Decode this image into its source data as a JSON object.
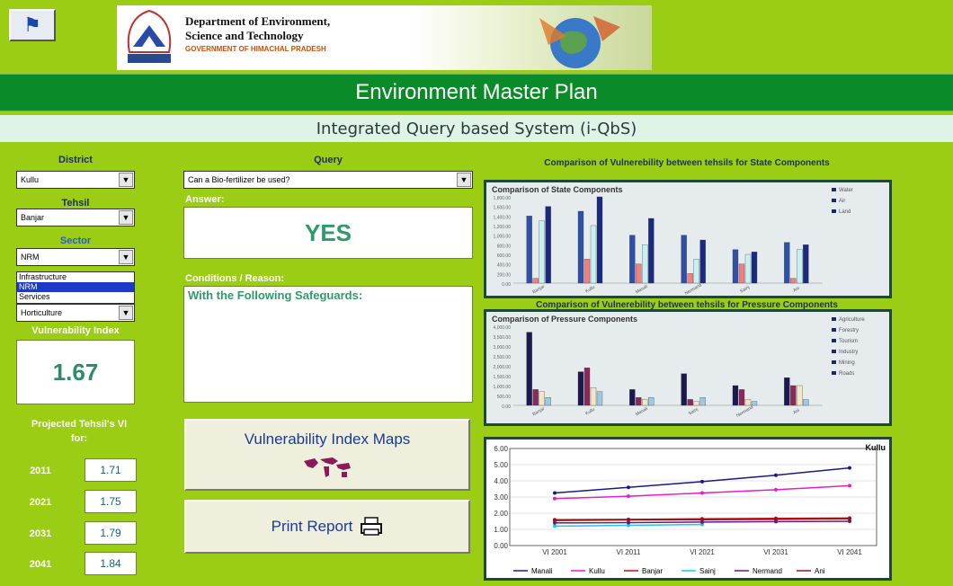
{
  "header": {
    "dept_line1": "Department of Environment,",
    "dept_line2": "Science and Technology",
    "dept_line3": "GOVERNMENT OF HIMACHAL PRADESH",
    "title": "Environment Master Plan",
    "subtitle": "Integrated Query based System (i-QbS)"
  },
  "filters": {
    "district_label": "District",
    "district_value": "Kullu",
    "tehsil_label": "Tehsil",
    "tehsil_value": "Banjar",
    "sector_label": "Sector",
    "sector_value": "NRM",
    "sector_options": [
      "Infrastructure",
      "NRM",
      "Services"
    ],
    "subsector_value": "Horticulture"
  },
  "vulnerability": {
    "label": "Vulnerability Index",
    "value": "1.67",
    "projected_label": "Projected Tehsil's VI for:",
    "years": [
      {
        "year": "2011",
        "value": "1.71"
      },
      {
        "year": "2021",
        "value": "1.75"
      },
      {
        "year": "2031",
        "value": "1.79"
      },
      {
        "year": "2041",
        "value": "1.84"
      }
    ]
  },
  "query": {
    "label": "Query",
    "value": "Can a Bio-fertilizer be used?",
    "answer_label": "Answer:",
    "answer": "YES",
    "conditions_label": "Conditions / Reason:",
    "conditions_text": "With the Following Safeguards:"
  },
  "buttons": {
    "maps": "Vulnerability Index Maps",
    "print": "Print Report"
  },
  "charts": {
    "state_title": "Comparison of Vulnerebility between tehsils for State Components",
    "state_inner_title": "Comparison of State Components",
    "pressure_title": "Comparison of Vulnerebility between tehsils for Pressure Components",
    "pressure_inner_title": "Comparison of Pressure Components"
  },
  "chart_data": [
    {
      "type": "bar",
      "title": "Comparison of State Components",
      "categories": [
        "Banjar",
        "Kullu",
        "Manali",
        "Nermand",
        "Sainj",
        "Ani"
      ],
      "ylim": [
        0,
        1800
      ],
      "ytick_labels": [
        "1,800.00",
        "1,600.00",
        "1,400.00",
        "1,200.00",
        "1,000.00",
        "800.00",
        "600.00",
        "400.00",
        "200.00",
        "0.00"
      ],
      "legend_labels": [
        "Water",
        "Air",
        "Land"
      ],
      "legend_position": "right",
      "series": [
        {
          "name": "Water",
          "color": "#3050a8",
          "values": [
            1400,
            1500,
            1000,
            1000,
            700,
            850
          ]
        },
        {
          "name": "Air",
          "color": "#f08080",
          "values": [
            100,
            500,
            400,
            200,
            400,
            100
          ]
        },
        {
          "name": "Land",
          "color": "#c8f0f0",
          "values": [
            1300,
            1200,
            800,
            500,
            600,
            700
          ]
        },
        {
          "name": "",
          "color": "#1a2a80",
          "values": [
            1600,
            1850,
            1350,
            900,
            650,
            800
          ]
        }
      ]
    },
    {
      "type": "bar",
      "title": "Comparison of Pressure Components",
      "categories": [
        "Banjar",
        "Kullu",
        "Manali",
        "Sainj",
        "Nermand",
        "Ani"
      ],
      "ylim": [
        0,
        4000
      ],
      "ytick_labels": [
        "4,000.00",
        "3,500.00",
        "3,000.00",
        "2,500.00",
        "2,000.00",
        "1,500.00",
        "1,000.00",
        "500.00",
        "0.00"
      ],
      "legend_labels": [
        "Agriculture",
        "Forestry",
        "Tourism",
        "Industry",
        "Mining",
        "Roads"
      ],
      "legend_position": "right",
      "series": [
        {
          "name": "",
          "color": "#1a1a50",
          "values": [
            3700,
            1700,
            800,
            1600,
            1000,
            1400
          ]
        },
        {
          "name": "",
          "color": "#8a2a5a",
          "values": [
            800,
            1900,
            400,
            300,
            800,
            1000
          ]
        },
        {
          "name": "",
          "color": "#f0e6c8",
          "values": [
            700,
            900,
            300,
            200,
            300,
            1000
          ]
        },
        {
          "name": "",
          "color": "#a0c8e0",
          "values": [
            400,
            700,
            400,
            400,
            200,
            300
          ]
        }
      ]
    },
    {
      "type": "line",
      "title": "Kullu",
      "categories": [
        "VI 2001",
        "VI 2011",
        "VI 2021",
        "VI 2031",
        "VI 2041"
      ],
      "ylim": [
        0,
        6
      ],
      "yticks": [
        "6.00",
        "5.00",
        "4.00",
        "3.00",
        "2.00",
        "1.00",
        "0.00"
      ],
      "legend_position": "bottom",
      "series": [
        {
          "name": "Manali",
          "color": "#1a1a80",
          "values": [
            3.25,
            3.6,
            3.95,
            4.35,
            4.8
          ]
        },
        {
          "name": "Kullu",
          "color": "#e020c8",
          "values": [
            2.9,
            3.05,
            3.25,
            3.45,
            3.7
          ]
        },
        {
          "name": "Banjar",
          "color": "#c01010",
          "values": [
            1.6,
            1.62,
            1.65,
            1.68,
            1.7
          ]
        },
        {
          "name": "Sainj",
          "color": "#20c8e0",
          "values": [
            1.2,
            1.25,
            1.3,
            null,
            null
          ]
        },
        {
          "name": "Nermand",
          "color": "#5a1a8a",
          "values": [
            1.4,
            1.42,
            1.45,
            1.48,
            1.5
          ]
        },
        {
          "name": "Ani",
          "color": "#8a1a1a",
          "values": [
            1.55,
            1.58,
            1.6,
            1.62,
            1.65
          ]
        }
      ]
    }
  ]
}
